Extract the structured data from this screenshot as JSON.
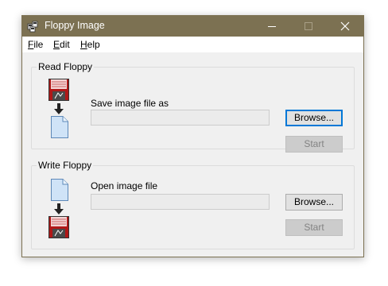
{
  "window": {
    "title": "Floppy Image",
    "title_bar_color": "#7c7152",
    "controls": [
      "minimize-icon",
      "maximize-icon",
      "close-icon"
    ]
  },
  "menu": {
    "items": [
      {
        "accel": "F",
        "rest": "ile"
      },
      {
        "accel": "E",
        "rest": "dit"
      },
      {
        "accel": "H",
        "rest": "elp"
      }
    ]
  },
  "read_floppy": {
    "group_title": "Read Floppy",
    "field_label": "Save image file as",
    "field_value": "",
    "browse_label": "Browse...",
    "start_label": "Start",
    "start_enabled": false,
    "icons": [
      "floppy-disk-icon",
      "arrow-down-icon",
      "document-icon"
    ]
  },
  "write_floppy": {
    "group_title": "Write Floppy",
    "field_label": "Open image file",
    "field_value": "",
    "browse_label": "Browse...",
    "start_label": "Start",
    "start_enabled": false,
    "icons": [
      "document-icon",
      "arrow-down-icon",
      "floppy-disk-icon"
    ]
  },
  "colors": {
    "accent_focus": "#0078d7",
    "window_bg": "#f0f0f0",
    "disabled_text": "#838383"
  }
}
